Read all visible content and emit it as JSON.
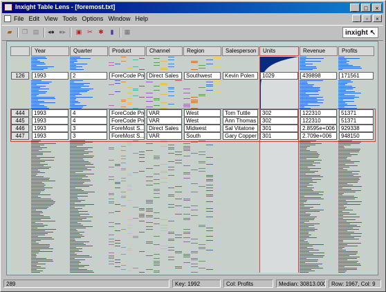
{
  "window": {
    "title": "Inxight Table Lens - [foremost.txt]",
    "min": "_",
    "max": "□",
    "close": "×"
  },
  "menu": [
    "File",
    "Edit",
    "View",
    "Tools",
    "Options",
    "Window",
    "Help"
  ],
  "mdi": {
    "min": "_",
    "restore": "▫",
    "close": "×"
  },
  "logo": "inxight ↖",
  "columns": [
    {
      "label": "Year",
      "type": "num",
      "color": "#1f64e0"
    },
    {
      "label": "Quarter",
      "type": "num",
      "color": "#1f64e0"
    },
    {
      "label": "Product",
      "type": "cat",
      "palette": [
        "#c060c0",
        "#5060c0",
        "#e08a30",
        "#f0c040",
        "#50b0b0",
        "#806060"
      ]
    },
    {
      "label": "Channel",
      "type": "cat",
      "palette": [
        "#a050c0",
        "#50a050",
        "#e0c040",
        "#4080d0",
        "#c05050"
      ]
    },
    {
      "label": "Region",
      "type": "cat",
      "palette": [
        "#a060b0",
        "#c07030",
        "#60a050",
        "#4070c0",
        "#f0d050"
      ]
    },
    {
      "label": "Salesperson",
      "type": "text",
      "color": "#c8d0cc"
    },
    {
      "label": "Units",
      "type": "sorted",
      "color": "#0a2a80"
    },
    {
      "label": "Revenue",
      "type": "num",
      "color": "#1f64e0"
    },
    {
      "label": "Profits",
      "type": "num",
      "color": "#1f64e0"
    }
  ],
  "rows": [
    {
      "idx": "126",
      "cells": [
        "1993",
        "2",
        "ForeCode Pro",
        "Direct Sales",
        "Southwest",
        "Kevin Polen",
        "1029",
        "439898",
        "171561"
      ]
    },
    {
      "idx": "444",
      "cells": [
        "1993",
        "4",
        "ForeCode Pro",
        "VAR",
        "West",
        "Tom Tuttle",
        "302",
        "122310",
        "51371"
      ]
    },
    {
      "idx": "445",
      "cells": [
        "1993",
        "4",
        "ForeCode Pro",
        "VAR",
        "West",
        "Ann Thomas",
        "302",
        "122310",
        "51371"
      ]
    },
    {
      "idx": "446",
      "cells": [
        "1993",
        "3",
        "ForeMost S...",
        "Direct Sales",
        "Midwest",
        "Sal Vitatone",
        "301",
        "2.8595e+006",
        "929338"
      ]
    },
    {
      "idx": "447",
      "cells": [
        "1993",
        "3",
        "ForeMost S...",
        "VAR",
        "South",
        "Gary Copper",
        "301",
        "2.709e+006",
        "948150"
      ]
    }
  ],
  "status": {
    "count": "289",
    "key": "Key: 1992",
    "col": "Col: Profits",
    "median": "Median: 30813.00001",
    "rowcol": "Row: 1967, Col: 9"
  }
}
